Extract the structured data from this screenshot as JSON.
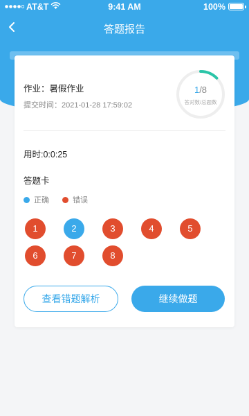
{
  "status_bar": {
    "carrier": "AT&T",
    "time": "9:41 AM",
    "battery": "100%"
  },
  "nav": {
    "title": "答题报告"
  },
  "report": {
    "homework": "作业：暑假作业",
    "submit_time": "提交时间：2021-01-28 17:59:02",
    "correct_count": "1",
    "total_count": "/8",
    "ratio_label": "答对数/总题数",
    "progress_fraction": 0.125,
    "time_used": "用时:0:0:25"
  },
  "answer_card": {
    "title": "答题卡",
    "legend_correct": "正确",
    "legend_wrong": "错误",
    "questions": [
      {
        "label": "1",
        "status": "wrong"
      },
      {
        "label": "2",
        "status": "correct"
      },
      {
        "label": "3",
        "status": "wrong"
      },
      {
        "label": "4",
        "status": "wrong"
      },
      {
        "label": "5",
        "status": "wrong"
      },
      {
        "label": "6",
        "status": "wrong"
      },
      {
        "label": "7",
        "status": "wrong"
      },
      {
        "label": "8",
        "status": "wrong"
      }
    ]
  },
  "actions": {
    "view_mistakes": "查看错题解析",
    "continue": "继续做题"
  },
  "colors": {
    "primary": "#3aa9ea",
    "wrong": "#e14d2e",
    "ring_progress": "#2bc5a8",
    "ring_track": "#eeeeee"
  }
}
